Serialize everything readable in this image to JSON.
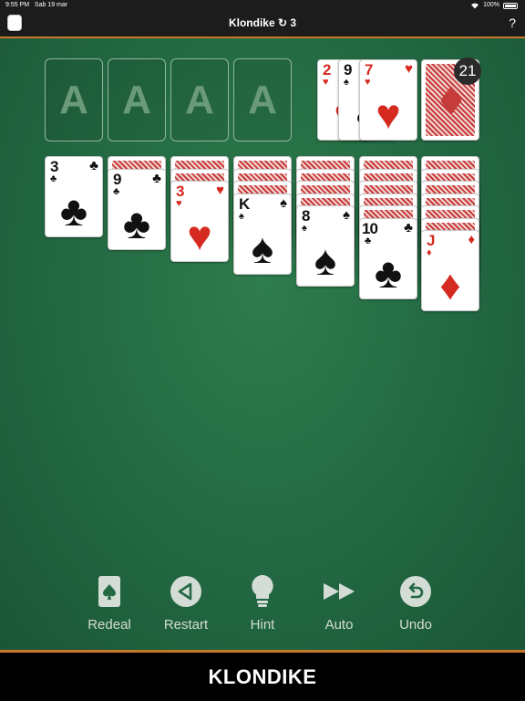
{
  "status_bar": {
    "time": "9:55 PM",
    "date": "Sab 19 mar",
    "battery": "100%"
  },
  "header": {
    "title": "Klondike ↻ 3",
    "help_label": "?"
  },
  "foundations": [
    {
      "label": "A"
    },
    {
      "label": "A"
    },
    {
      "label": "A"
    },
    {
      "label": "A"
    }
  ],
  "waste": [
    {
      "rank": "2",
      "suit": "♥",
      "color": "red"
    },
    {
      "rank": "9",
      "suit": "♠",
      "color": "black"
    },
    {
      "rank": "7",
      "suit": "♥",
      "color": "red"
    }
  ],
  "stock": {
    "count": "21"
  },
  "tableau": [
    {
      "face_down": 0,
      "card": {
        "rank": "3",
        "suit": "♣",
        "color": "black"
      }
    },
    {
      "face_down": 1,
      "card": {
        "rank": "9",
        "suit": "♣",
        "color": "black"
      }
    },
    {
      "face_down": 2,
      "card": {
        "rank": "3",
        "suit": "♥",
        "color": "red"
      }
    },
    {
      "face_down": 3,
      "card": {
        "rank": "K",
        "suit": "♠",
        "color": "black"
      }
    },
    {
      "face_down": 4,
      "card": {
        "rank": "8",
        "suit": "♠",
        "color": "black"
      }
    },
    {
      "face_down": 5,
      "card": {
        "rank": "10",
        "suit": "♣",
        "color": "black"
      }
    },
    {
      "face_down": 6,
      "card": {
        "rank": "J",
        "suit": "♦",
        "color": "red"
      }
    }
  ],
  "toolbar": {
    "redeal": "Redeal",
    "restart": "Restart",
    "hint": "Hint",
    "auto": "Auto",
    "undo": "Undo"
  },
  "footer": {
    "title": "KLONDIKE"
  },
  "colors": {
    "felt": "#226842",
    "accent_rule": "#c9772c",
    "card_red": "#d42a20",
    "card_back": "#c63c3a"
  }
}
